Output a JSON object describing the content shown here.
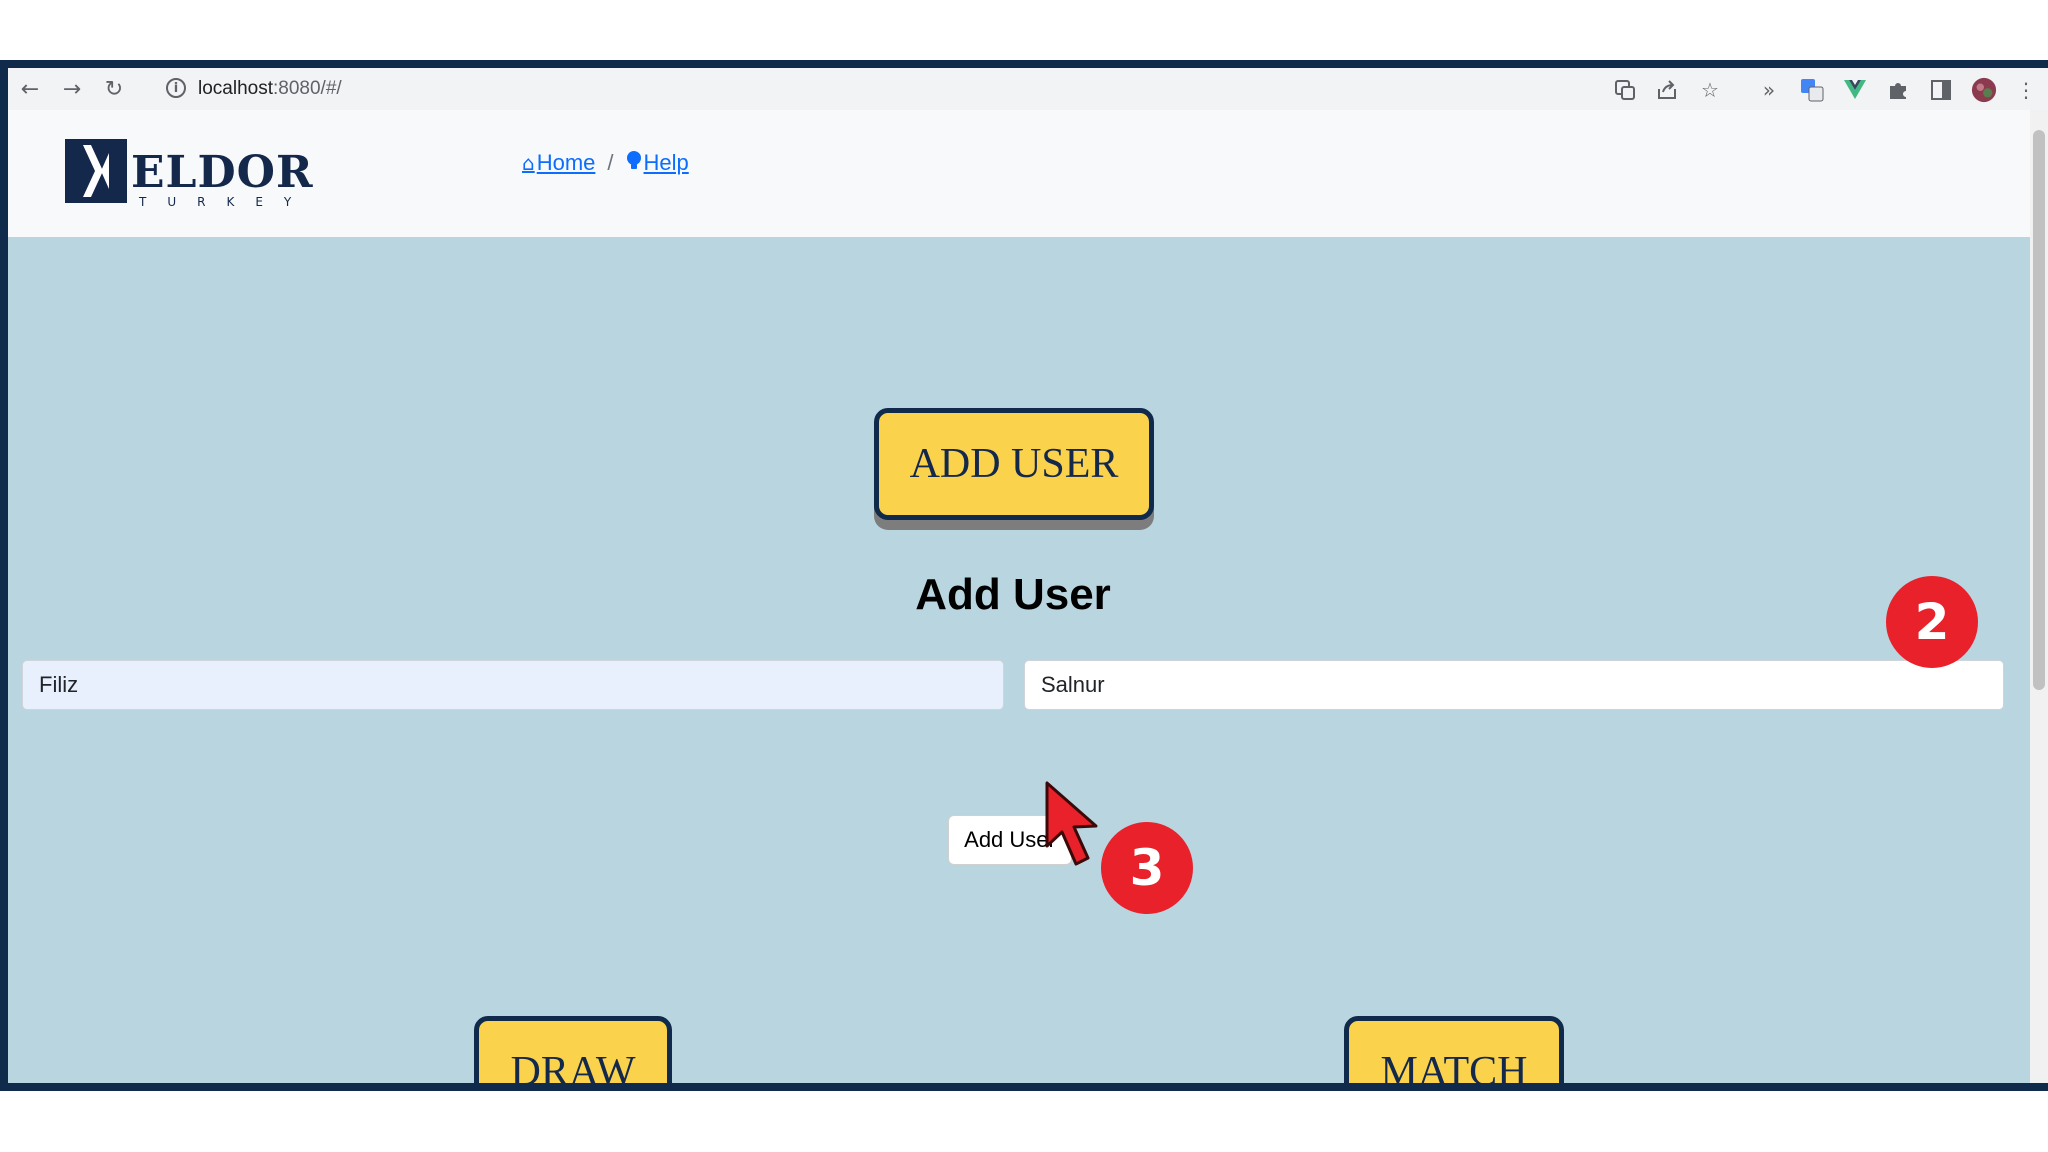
{
  "browser": {
    "url_host": "localhost",
    "url_path": ":8080/#/",
    "nav": {
      "back_icon": "←",
      "forward_icon": "→",
      "reload_icon": "↻"
    },
    "extensions": [
      "translate-icon",
      "share-icon",
      "star-icon",
      "extension-chevron-icon",
      "google-translate-icon",
      "vue-devtools-icon",
      "puzzle-icon",
      "sidepanel-icon",
      "profile-avatar"
    ]
  },
  "header": {
    "logo_text": "ELDOR",
    "logo_subtext": "TURKEY",
    "breadcrumb": {
      "home": "Home",
      "separator": "/",
      "help": "Help"
    }
  },
  "main": {
    "add_user_big_button": "ADD USER",
    "form_title": "Add User",
    "first_name_value": "Filiz",
    "last_name_value": "Salnur",
    "submit_button": "Add User",
    "draw_button": "DRAW",
    "match_button": "MATCH"
  },
  "annotations": {
    "badge_2": "2",
    "badge_3": "3",
    "badge_color": "#e8212b"
  },
  "colors": {
    "background": "#b8d5e0",
    "button_yellow": "#fad24c",
    "navy": "#102a4c",
    "link": "#0d6efd"
  }
}
